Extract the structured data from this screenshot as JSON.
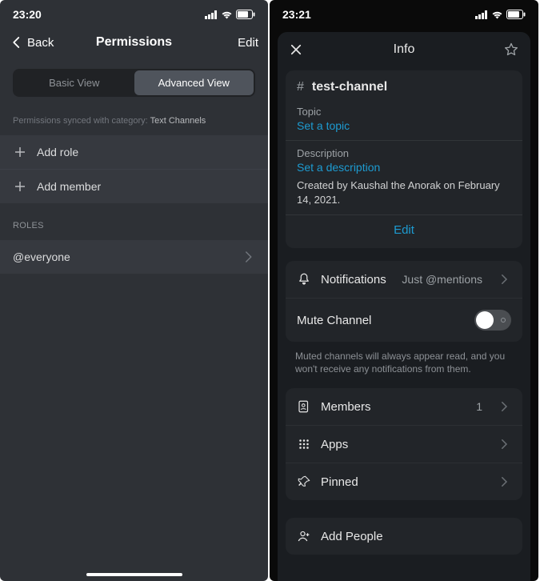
{
  "left": {
    "status": {
      "time": "23:20"
    },
    "nav": {
      "back": "Back",
      "title": "Permissions",
      "edit": "Edit"
    },
    "tabs": {
      "basic": "Basic View",
      "advanced": "Advanced View"
    },
    "sync_prefix": "Permissions synced with category: ",
    "sync_category": "Text Channels",
    "add_role": "Add role",
    "add_member": "Add member",
    "roles_header": "ROLES",
    "everyone": "@everyone"
  },
  "right": {
    "status": {
      "time": "23:21"
    },
    "nav": {
      "title": "Info"
    },
    "channel": {
      "name": "test-channel",
      "topic_label": "Topic",
      "topic_placeholder": "Set a topic",
      "desc_label": "Description",
      "desc_placeholder": "Set a description",
      "created": "Created by Kaushal the Anorak on February 14, 2021.",
      "edit": "Edit"
    },
    "rows": {
      "notifications": "Notifications",
      "notifications_value": "Just @mentions",
      "mute": "Mute Channel",
      "mute_hint": "Muted channels will always appear read, and you won't receive any notifications from them.",
      "members": "Members",
      "members_count": "1",
      "apps": "Apps",
      "pinned": "Pinned",
      "add_people": "Add People"
    }
  }
}
